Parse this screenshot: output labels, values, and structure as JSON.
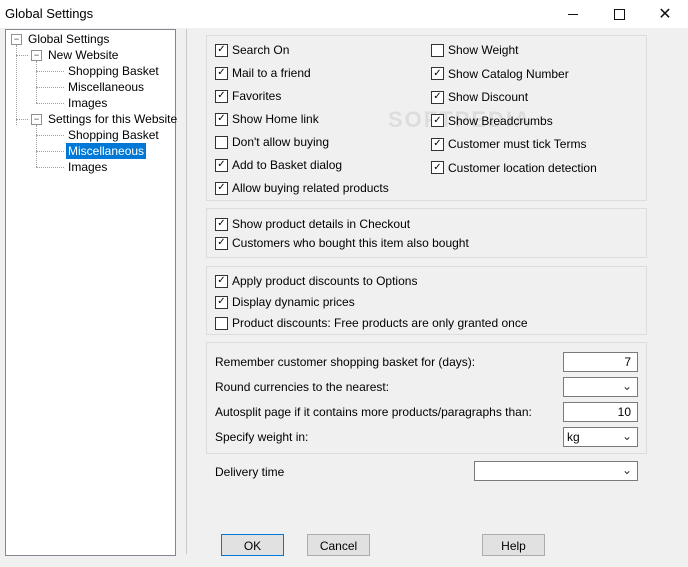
{
  "window": {
    "title": "Global Settings",
    "minimize_icon": "minimize-icon",
    "maximize_icon": "maximize-icon",
    "close_icon": "close-icon",
    "close_glyph": "✕"
  },
  "tree": {
    "root": "Global Settings",
    "new_website": "New Website",
    "nw_shopping_basket": "Shopping Basket",
    "nw_miscellaneous": "Miscellaneous",
    "nw_images": "Images",
    "settings_site": "Settings for this Website",
    "ss_shopping_basket": "Shopping Basket",
    "ss_miscellaneous": "Miscellaneous",
    "ss_images": "Images",
    "expander_glyph": "−"
  },
  "options_left": [
    {
      "label": "Search On",
      "checked": true
    },
    {
      "label": "Mail to a friend",
      "checked": true
    },
    {
      "label": "Favorites",
      "checked": true
    },
    {
      "label": "Show Home link",
      "checked": true
    },
    {
      "label": "Don't allow buying",
      "checked": false
    },
    {
      "label": "Add to Basket dialog",
      "checked": true
    },
    {
      "label": "Allow buying related products",
      "checked": true
    }
  ],
  "options_right": [
    {
      "label": "Show Weight",
      "checked": false
    },
    {
      "label": "Show Catalog Number",
      "checked": true
    },
    {
      "label": "Show Discount",
      "checked": true
    },
    {
      "label": "Show Breadcrumbs",
      "checked": true
    },
    {
      "label": "Customer must tick Terms",
      "checked": true
    },
    {
      "label": "Customer location detection",
      "checked": true
    }
  ],
  "checkout_options": [
    {
      "label": "Show product details in Checkout",
      "checked": true
    },
    {
      "label": "Customers who bought this item also bought",
      "checked": true
    }
  ],
  "discount_options": [
    {
      "label": "Apply product discounts to Options",
      "checked": true
    },
    {
      "label": "Display dynamic prices",
      "checked": true
    },
    {
      "label": "Product discounts: Free products are only granted once",
      "checked": false
    }
  ],
  "settings": {
    "remember_label": "Remember customer shopping basket for (days):",
    "remember_value": "7",
    "round_label": "Round currencies to the nearest:",
    "round_value": "",
    "autosplit_label": "Autosplit page if it contains more products/paragraphs than:",
    "autosplit_value": "10",
    "weight_label": "Specify weight in:",
    "weight_value": "kg",
    "delivery_label": "Delivery time",
    "delivery_value": "",
    "dropdown_glyph": "⌄"
  },
  "buttons": {
    "ok": "OK",
    "cancel": "Cancel",
    "help": "Help"
  },
  "watermark": "SOFTPEDIA"
}
